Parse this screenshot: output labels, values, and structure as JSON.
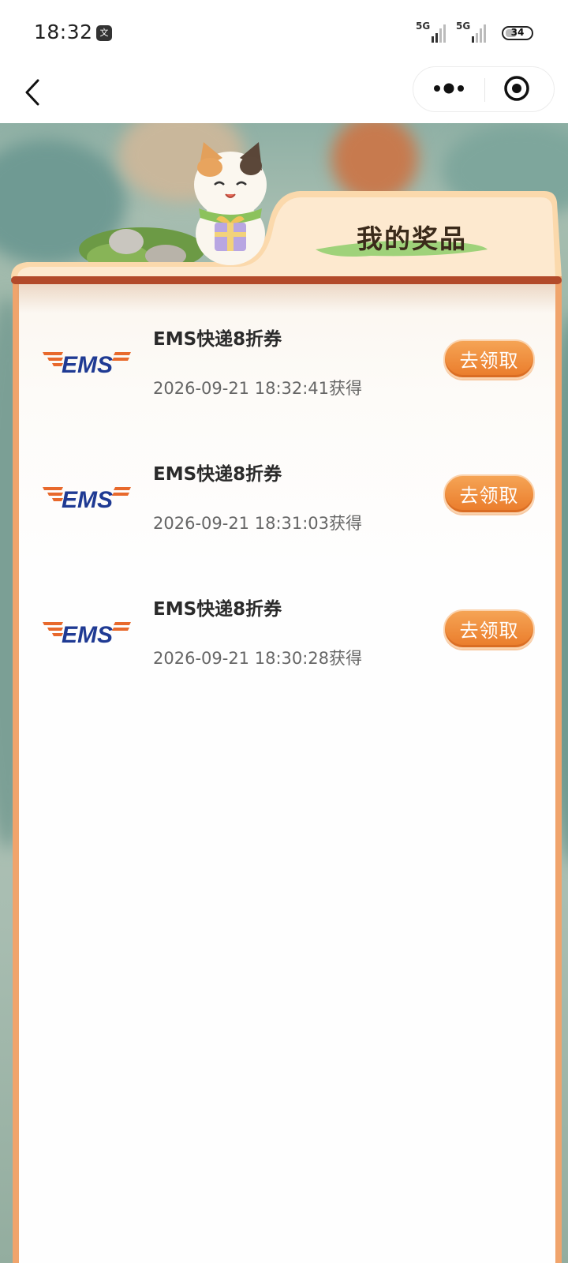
{
  "status_bar": {
    "time": "18:32",
    "app_icon_glyph": "文",
    "network_1": "5G",
    "network_2": "5G",
    "battery": "34"
  },
  "nav": {
    "back_icon": "chevron-left-icon",
    "more_icon": "more-dots-icon",
    "target_icon": "target-icon"
  },
  "page": {
    "title": "我的奖品"
  },
  "prizes": [
    {
      "logo_text": "EMS",
      "name": "EMS快递8折券",
      "time": "2026-09-21 18:32:41获得",
      "button": "去领取"
    },
    {
      "logo_text": "EMS",
      "name": "EMS快递8折券",
      "time": "2026-09-21 18:31:03获得",
      "button": "去领取"
    },
    {
      "logo_text": "EMS",
      "name": "EMS快递8折券",
      "time": "2026-09-21 18:30:28获得",
      "button": "去领取"
    }
  ],
  "colors": {
    "accent": "#ea7b2a",
    "card_border": "#f0a46c",
    "ems_blue": "#1f3a93",
    "ems_orange": "#e8692c"
  }
}
